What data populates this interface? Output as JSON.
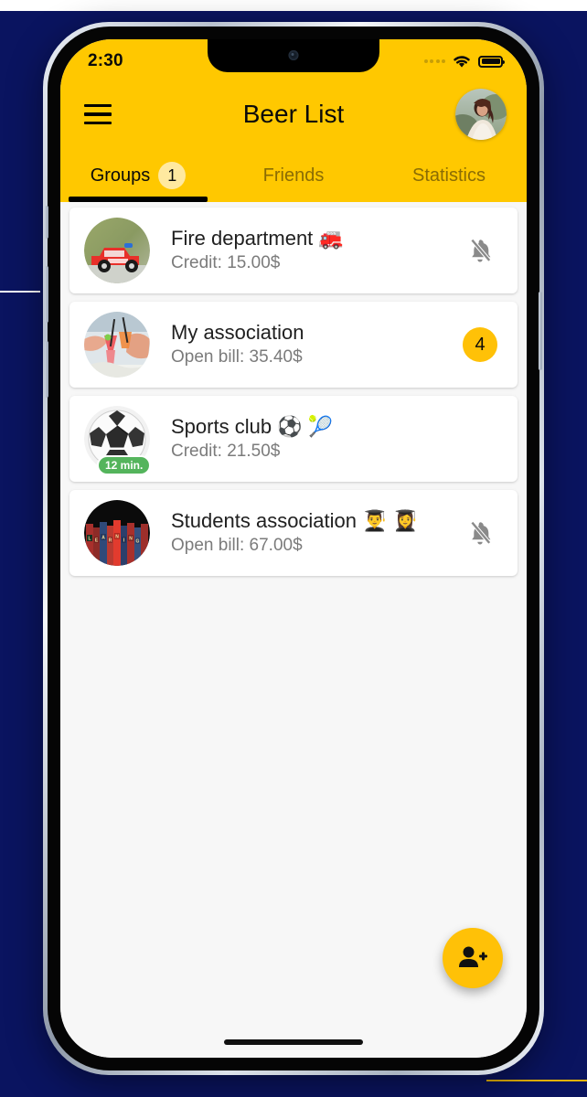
{
  "status_bar": {
    "time": "2:30",
    "signal_icon": "signal-dots-icon",
    "wifi_icon": "wifi-icon",
    "battery_icon": "battery-full-icon"
  },
  "app_bar": {
    "menu_icon": "hamburger-menu-icon",
    "title": "Beer List",
    "avatar_alt": "profile-photo"
  },
  "tabs": [
    {
      "label": "Groups",
      "badge": "1",
      "active": true
    },
    {
      "label": "Friends",
      "badge": "",
      "active": false
    },
    {
      "label": "Statistics",
      "badge": "",
      "active": false
    }
  ],
  "groups": [
    {
      "title": "Fire department 🚒",
      "subtitle": "Credit: 15.00$",
      "right_type": "muted",
      "right_icon": "bell-off-icon",
      "badge": "",
      "time_pill": "",
      "avatar": "fire-truck-photo"
    },
    {
      "title": "My association",
      "subtitle": "Open bill: 35.40$",
      "right_type": "badge",
      "right_icon": "",
      "badge": "4",
      "time_pill": "",
      "avatar": "cocktails-cheers-photo"
    },
    {
      "title": "Sports club ⚽ 🎾",
      "subtitle": "Credit: 21.50$",
      "right_type": "none",
      "right_icon": "",
      "badge": "",
      "time_pill": "12 min.",
      "avatar": "soccer-ball-photo"
    },
    {
      "title": "Students association 👨‍🎓 👩‍🎓",
      "subtitle": "Open bill: 67.00$",
      "right_type": "muted",
      "right_icon": "bell-off-icon",
      "badge": "",
      "time_pill": "",
      "avatar": "learning-books-photo"
    }
  ],
  "fab": {
    "icon": "person-add-icon",
    "label": ""
  },
  "colors": {
    "brand_yellow": "#ffc800",
    "accent_amber": "#ffc107",
    "badge_pale": "#ffe9a0",
    "green_pill": "#54b45c",
    "title_text": "#202020",
    "sub_text": "#7b7b7b",
    "muted_icon": "#8a8a8a",
    "backdrop_navy": "#0a1460",
    "screen_bg": "#f7f7f7"
  }
}
